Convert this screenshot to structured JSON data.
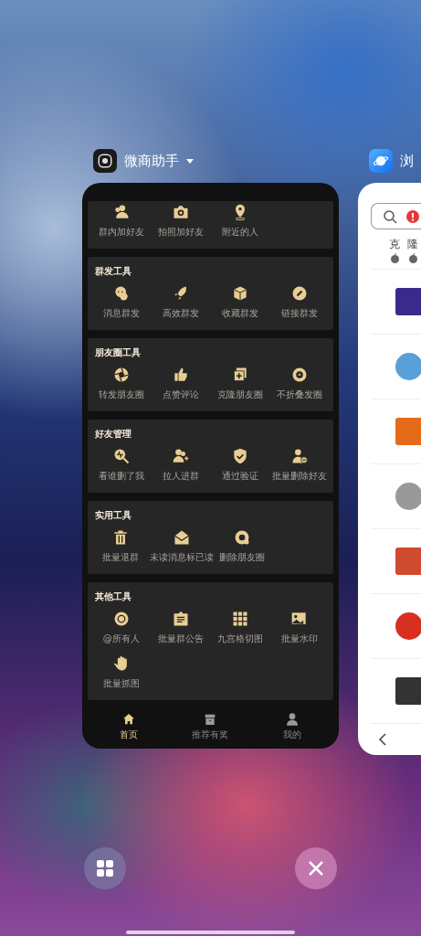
{
  "cards": [
    {
      "app_name": "微商助手"
    },
    {
      "app_name": "浏"
    }
  ],
  "first_section": {
    "items": [
      "群内加好友",
      "拍照加好友",
      "附近的人"
    ]
  },
  "sections": [
    {
      "title": "群发工具",
      "items": [
        "消息群发",
        "高效群发",
        "收藏群发",
        "链接群发"
      ]
    },
    {
      "title": "朋友圈工具",
      "items": [
        "转发朋友圈",
        "点赞评论",
        "克隆朋友圈",
        "不折叠发圈"
      ]
    },
    {
      "title": "好友管理",
      "items": [
        "看谁删了我",
        "拉人进群",
        "通过验证",
        "批量删除好友"
      ]
    },
    {
      "title": "实用工具",
      "items": [
        "批量退群",
        "未读消息标已读",
        "删除朋友圈"
      ]
    },
    {
      "title": "其他工具",
      "items": [
        "@所有人",
        "批量群公告",
        "九宫格切图",
        "批量水印",
        "批量抓图"
      ]
    }
  ],
  "bottom_nav": [
    {
      "label": "首页",
      "selected": true
    },
    {
      "label": "推荐有奖",
      "selected": false
    },
    {
      "label": "我的",
      "selected": false
    }
  ],
  "browser": {
    "tabs": [
      "克",
      "隆"
    ]
  }
}
